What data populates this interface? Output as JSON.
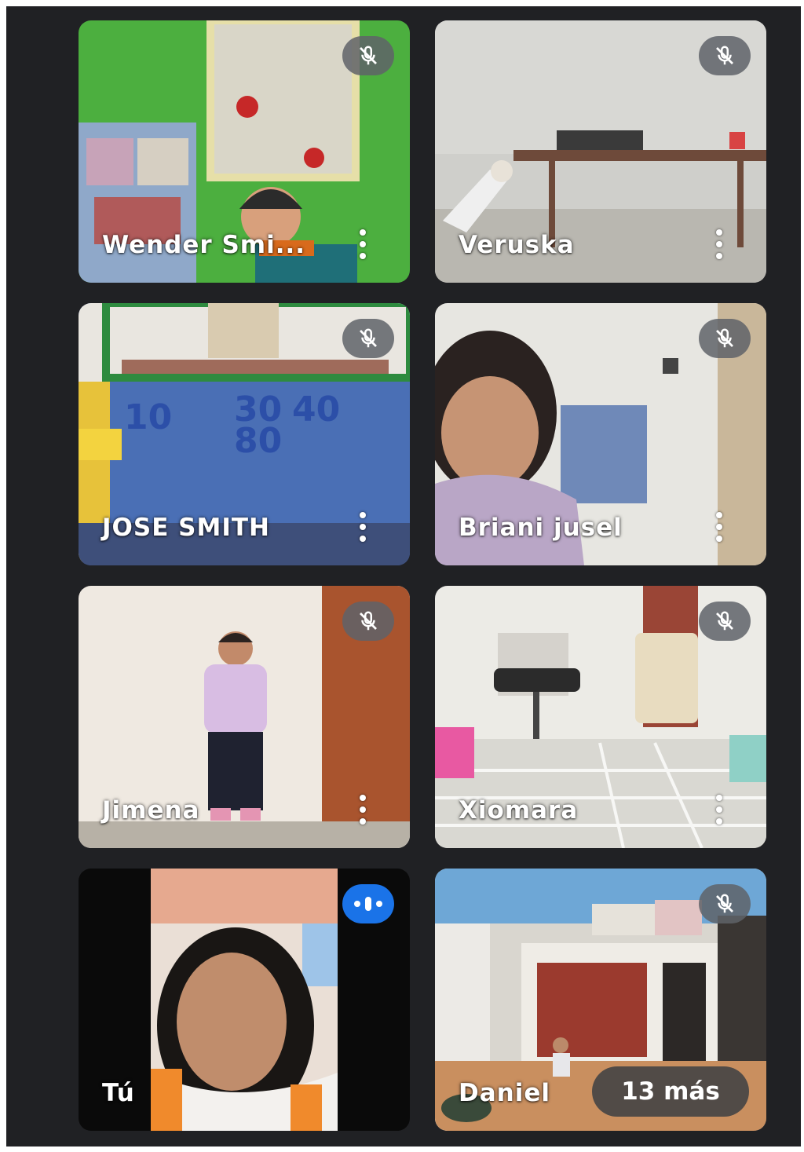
{
  "participants": [
    {
      "name": "Wender Smi...",
      "mic": "muted"
    },
    {
      "name": "Veruska",
      "mic": "muted"
    },
    {
      "name": "JOSE SMITH",
      "mic": "muted"
    },
    {
      "name": "Briani jusel",
      "mic": "muted"
    },
    {
      "name": "Jimena",
      "mic": "muted"
    },
    {
      "name": "Xiomara",
      "mic": "muted"
    },
    {
      "name": "Tú",
      "mic": "speaking"
    },
    {
      "name": "Daniel",
      "mic": "muted"
    }
  ],
  "overflow": {
    "label": "13 más"
  },
  "colors": {
    "background": "#202124",
    "muted_badge": "#5f6368",
    "speaking_badge": "#1a73e8"
  },
  "icons": {
    "muted": "mic-off-icon",
    "speaking": "audio-level-icon",
    "options": "more-vert-icon"
  }
}
